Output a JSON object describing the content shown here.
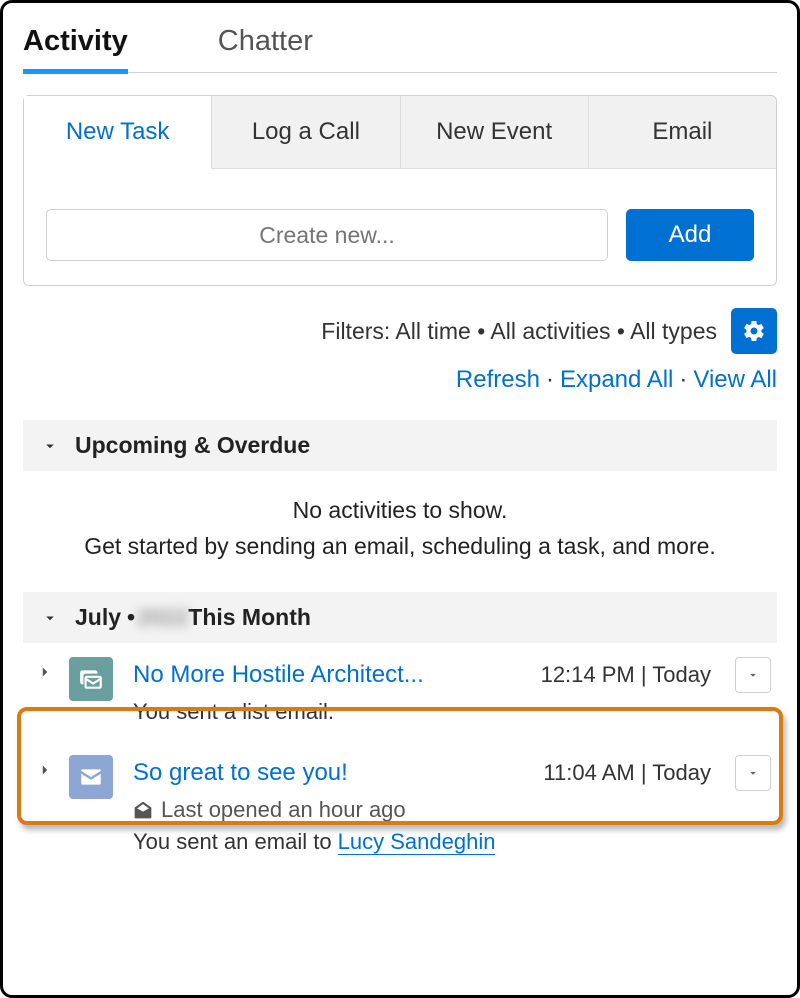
{
  "top_tabs": {
    "activity": "Activity",
    "chatter": "Chatter"
  },
  "composer": {
    "tabs": {
      "new_task": "New Task",
      "log_call": "Log a Call",
      "new_event": "New Event",
      "email": "Email"
    },
    "placeholder": "Create new...",
    "add_label": "Add"
  },
  "filters": {
    "text": "Filters: All time • All activities • All types",
    "refresh": "Refresh",
    "expand_all": "Expand All",
    "view_all": "View All"
  },
  "sections": {
    "upcoming_label": "Upcoming & Overdue",
    "empty_line1": "No activities to show.",
    "empty_line2": "Get started by sending an email, scheduling a task, and more."
  },
  "month": {
    "label": "July",
    "dot": "•",
    "year_blurred": "2022",
    "right": "This Month"
  },
  "items": [
    {
      "title": "No More Hostile Architect...",
      "time": "12:14 PM | Today",
      "sub": "You sent a list email."
    },
    {
      "title": "So great to see you!",
      "time": "11:04 AM | Today",
      "opened": "Last opened an hour ago",
      "sub_prefix": "You sent an email to ",
      "recipient": "Lucy Sandeghin"
    }
  ]
}
